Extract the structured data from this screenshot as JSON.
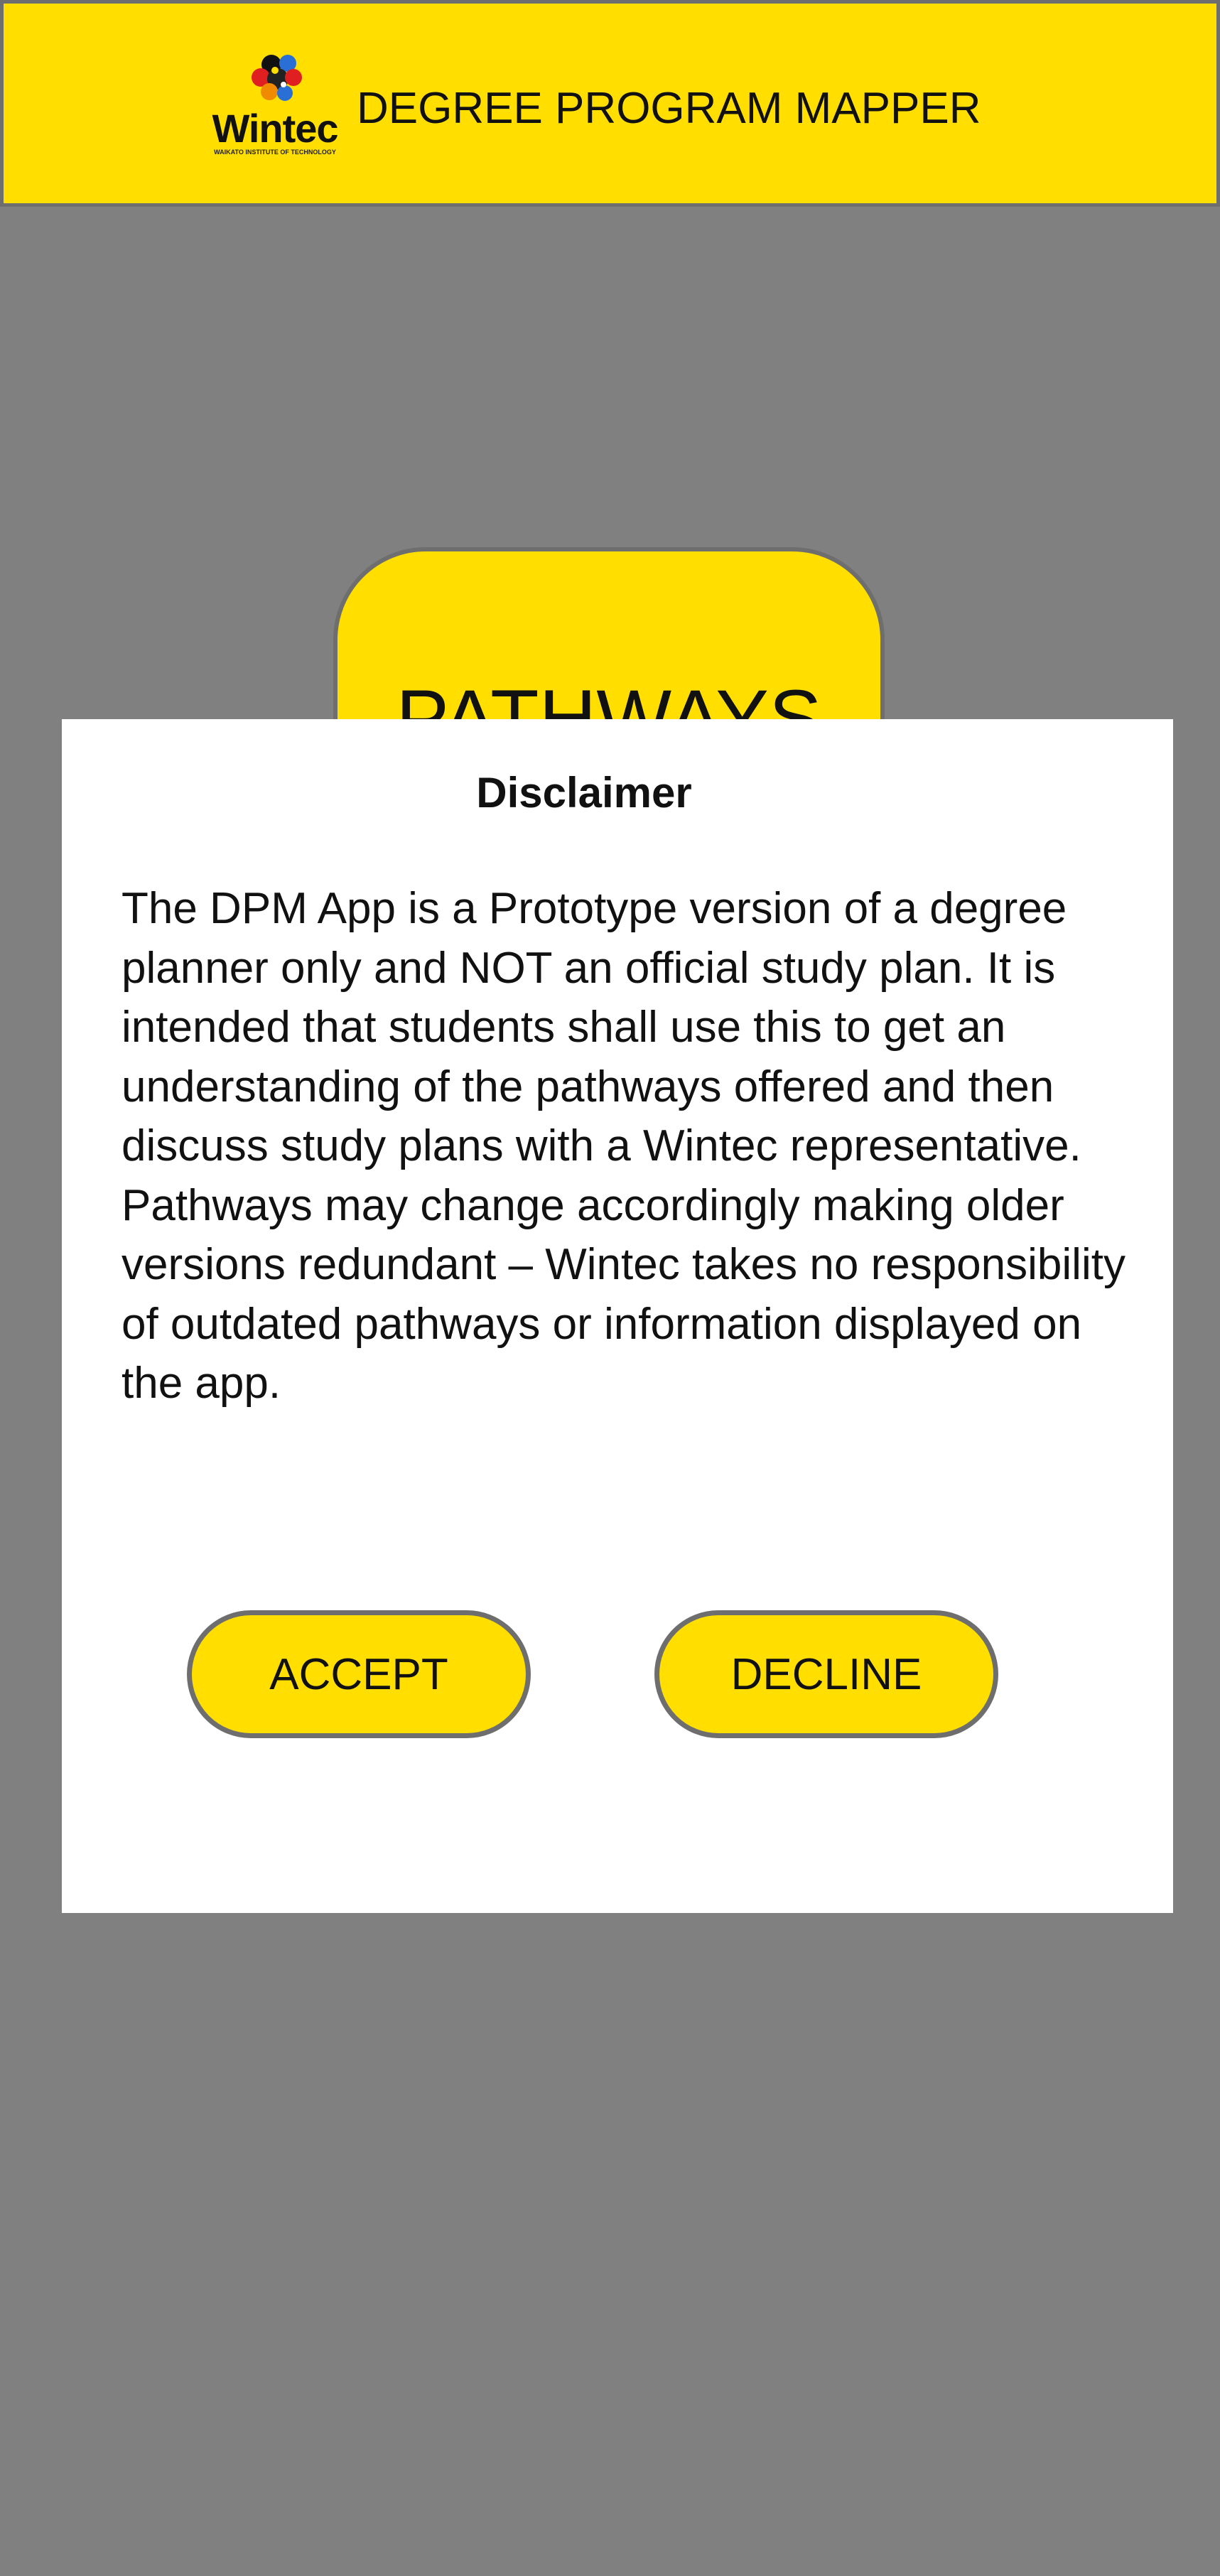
{
  "header": {
    "title": "DEGREE PROGRAM MAPPER",
    "logo": {
      "icon": "wintec-logo-icon",
      "wordmark": "Wintec",
      "tagline": "WAIKATO INSTITUTE OF TECHNOLOGY"
    }
  },
  "main": {
    "pathways_button_label": "PATHWAYS"
  },
  "modal": {
    "title": "Disclaimer",
    "body": "The DPM App is a Prototype version of a degree planner only and NOT an official study plan. It is intended that students shall use this to get an understanding of the pathways offered and then discuss study plans with a Wintec representative. Pathways may change accordingly making older versions redundant – Wintec takes no responsibility of outdated pathways or information displayed on the app.",
    "accept_label": "ACCEPT",
    "decline_label": "DECLINE"
  },
  "colors": {
    "brand_yellow": "#ffde00",
    "backdrop_gray": "#808080",
    "border_gray": "#6e6e6e",
    "text": "#111111",
    "modal_background": "#ffffff"
  }
}
